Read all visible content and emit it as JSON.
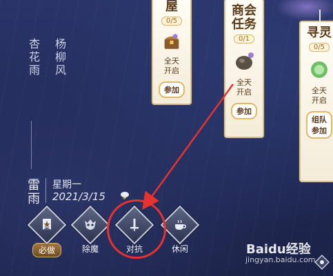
{
  "poem": {
    "line1": "杏花雨",
    "line2": "杨柳风"
  },
  "weather": {
    "name": "雷雨",
    "weekday": "星期一",
    "date": "2021/3/15",
    "icon": "thunderstorm-icon"
  },
  "categories": [
    {
      "label": "必做",
      "icon": "banner-icon",
      "badge": true
    },
    {
      "label": "除魔",
      "icon": "demon-mask-icon",
      "badge": false
    },
    {
      "label": "对抗",
      "icon": "crossed-swords-icon",
      "badge": false
    },
    {
      "label": "休闲",
      "icon": "teacup-icon",
      "badge": false
    }
  ],
  "cards": [
    {
      "title": "屋",
      "count": "0/5",
      "item_icon": "treasure-chest-icon",
      "time": [
        "全天",
        "开启"
      ],
      "button": "参加"
    },
    {
      "title": "商会任务",
      "title_lines": [
        "商会",
        "任务"
      ],
      "count": "0/1",
      "item_icon": "ore-stone-icon",
      "time": [
        "全天",
        "开启"
      ],
      "button": "参加"
    },
    {
      "title": "寻灵",
      "title_lines": [
        "寻灵"
      ],
      "count": "0/5",
      "item_icon": "spirit-orb-icon",
      "time": [
        "全天",
        "开启"
      ],
      "button_lines": [
        "组队",
        "参加"
      ]
    }
  ],
  "highlight_color": "#e8322f",
  "watermark": {
    "brand": "Baidu经验",
    "url": "jingyan.baidu.com"
  }
}
